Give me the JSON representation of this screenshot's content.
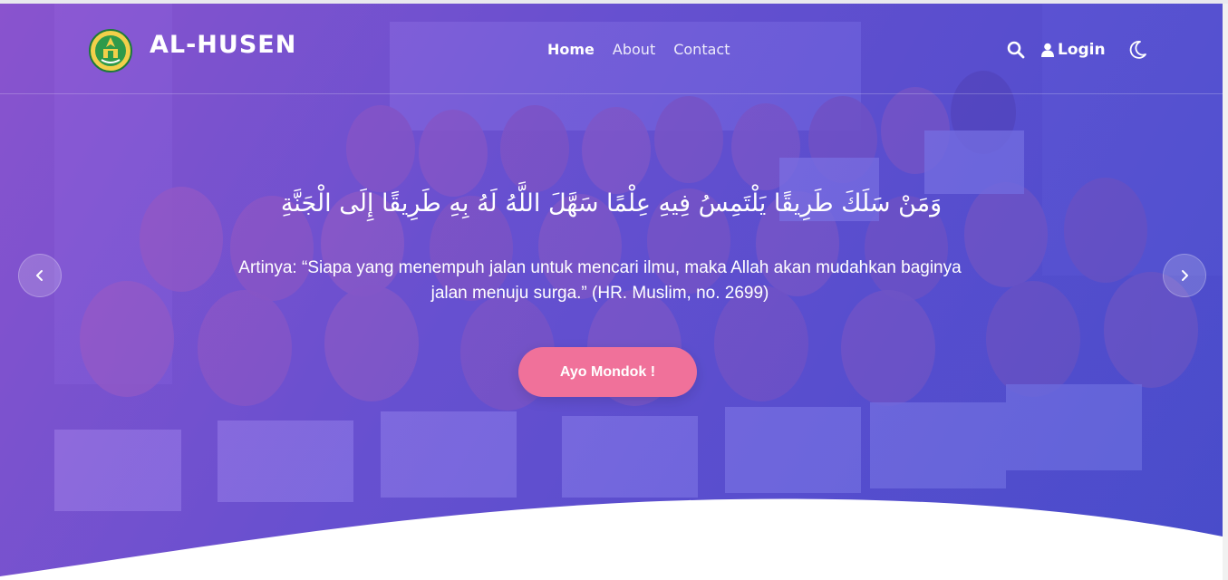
{
  "brand": {
    "name": "AL-HUSEN",
    "logo_icon": "emblem-logo-icon"
  },
  "nav": {
    "items": [
      {
        "label": "Home",
        "active": true
      },
      {
        "label": "About",
        "active": false
      },
      {
        "label": "Contact",
        "active": false
      }
    ],
    "search_icon": "search-icon",
    "login_label": "Login",
    "login_icon": "user-icon",
    "theme_icon": "moon-icon"
  },
  "hero": {
    "arabic_text": "وَمَنْ سَلَكَ طَرِيقًا يَلْتَمِسُ فِيهِ عِلْمًا سَهَّلَ اللَّهُ لَهُ بِهِ طَرِيقًا إِلَى الْجَنَّةِ",
    "translation": "Artinya: “Siapa yang menempuh jalan untuk mencari ilmu, maka Allah akan mudahkan baginya jalan menuju surga.” (HR. Muslim, no. 2699)",
    "cta_label": "Ayo Mondok !",
    "prev_icon": "chevron-left-icon",
    "next_icon": "chevron-right-icon"
  },
  "colors": {
    "gradient_start": "#8b4fd8",
    "gradient_end": "#3c47d2",
    "cta": "#f0719a",
    "text": "#ffffff"
  }
}
